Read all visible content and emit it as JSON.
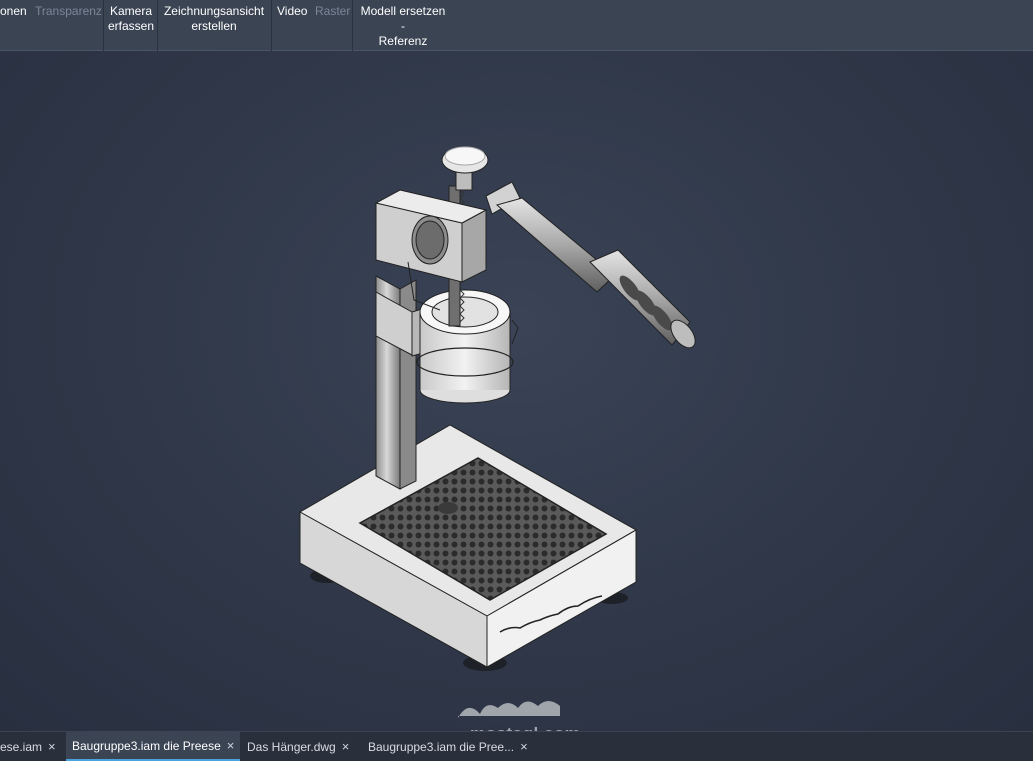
{
  "ribbon": {
    "items": [
      {
        "label": "onen",
        "disabled": false
      },
      {
        "label": "Transparenz",
        "disabled": true
      },
      {
        "label": "Kamera\nerfassen",
        "disabled": false
      },
      {
        "label": "Zeichnungsansicht\nerstellen",
        "disabled": false
      },
      {
        "label": "Video",
        "disabled": false
      },
      {
        "label": "Raster",
        "disabled": true
      },
      {
        "label": "Modell ersetzen -\nReferenz",
        "disabled": false
      }
    ]
  },
  "tabs": [
    {
      "label": "ese.iam",
      "active": false
    },
    {
      "label": "Baugruppe3.iam die Preese",
      "active": true
    },
    {
      "label": "Das Hänger.dwg",
      "active": false
    },
    {
      "label": "Baugruppe3.iam die Pree...",
      "active": false
    }
  ],
  "close_glyph": "×",
  "watermark": {
    "text": "mostaql.com"
  },
  "colors": {
    "ribbon_bg": "#3b4453",
    "viewport_bg": "#2f3748",
    "tab_active_accent": "#4aa3df"
  }
}
